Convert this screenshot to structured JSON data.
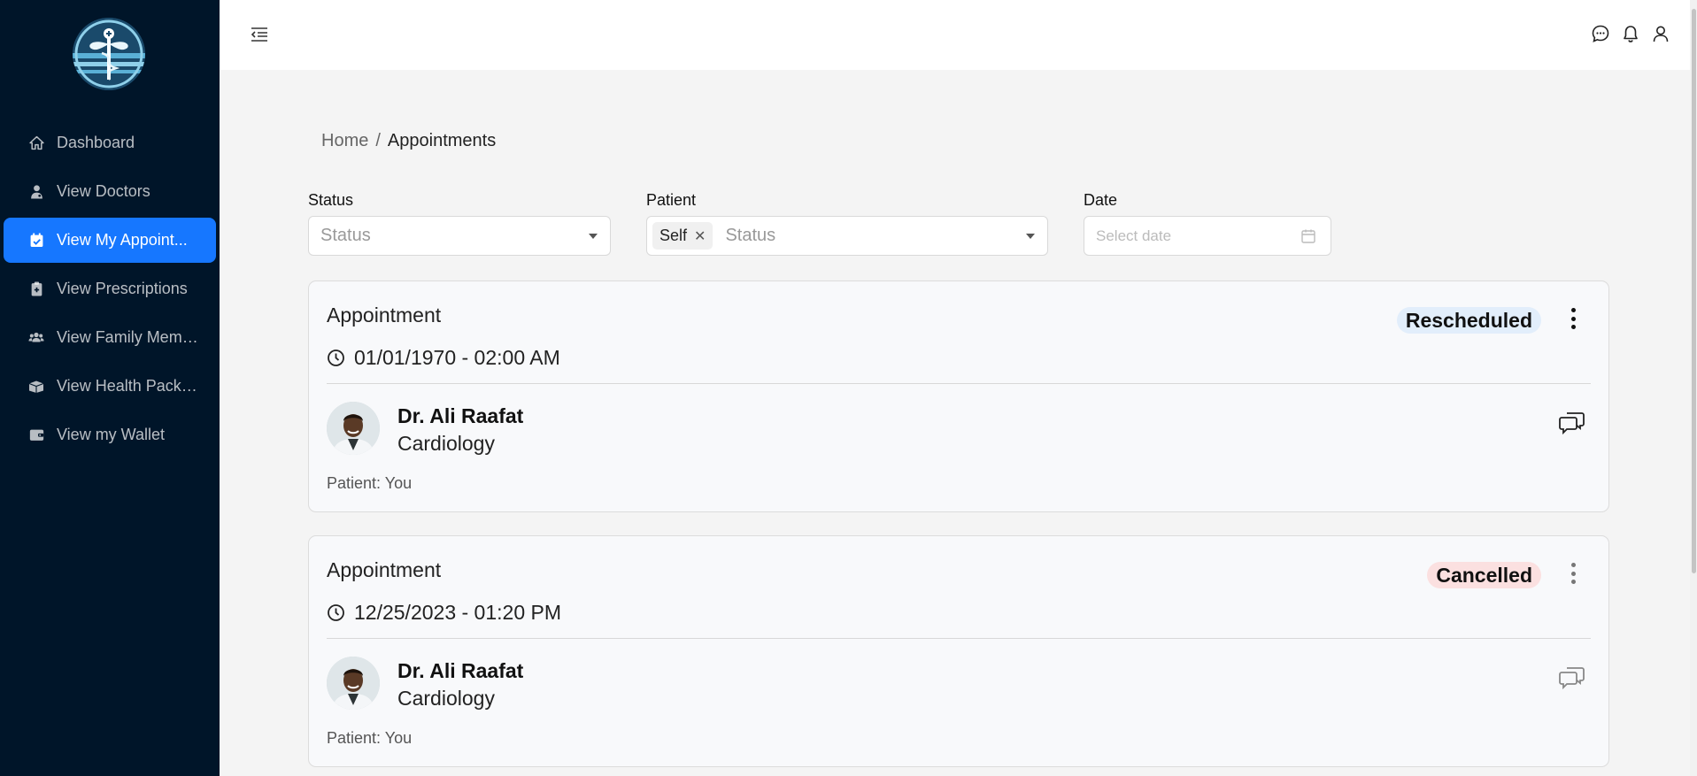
{
  "sidebar": {
    "items": [
      {
        "label": "Dashboard",
        "icon": "home-icon"
      },
      {
        "label": "View Doctors",
        "icon": "doctor-icon"
      },
      {
        "label": "View My Appoint...",
        "icon": "calendar-check-icon"
      },
      {
        "label": "View Prescriptions",
        "icon": "clipboard-icon"
      },
      {
        "label": "View Family Memb...",
        "icon": "users-icon"
      },
      {
        "label": "View Health Packa...",
        "icon": "box-icon"
      },
      {
        "label": "View my Wallet",
        "icon": "wallet-icon"
      }
    ],
    "active_index": 2
  },
  "breadcrumb": {
    "home": "Home",
    "separator": "/",
    "current": "Appointments"
  },
  "filters": {
    "status": {
      "label": "Status",
      "placeholder": "Status"
    },
    "patient": {
      "label": "Patient",
      "tag": "Self",
      "placeholder": "Status"
    },
    "date": {
      "label": "Date",
      "placeholder": "Select date"
    }
  },
  "appointments": [
    {
      "title": "Appointment",
      "datetime": "01/01/1970 - 02:00 AM",
      "status": "Rescheduled",
      "doctor": "Dr. Ali Raafat",
      "specialty": "Cardiology",
      "patient": "Patient: You"
    },
    {
      "title": "Appointment",
      "datetime": "12/25/2023 - 01:20 PM",
      "status": "Cancelled",
      "doctor": "Dr. Ali Raafat",
      "specialty": "Cardiology",
      "patient": "Patient: You"
    }
  ],
  "colors": {
    "sidebar_bg": "#001529",
    "active_item": "#1677ff",
    "rescheduled_badge": "#e2eefb",
    "cancelled_badge": "#fbe0e0"
  }
}
